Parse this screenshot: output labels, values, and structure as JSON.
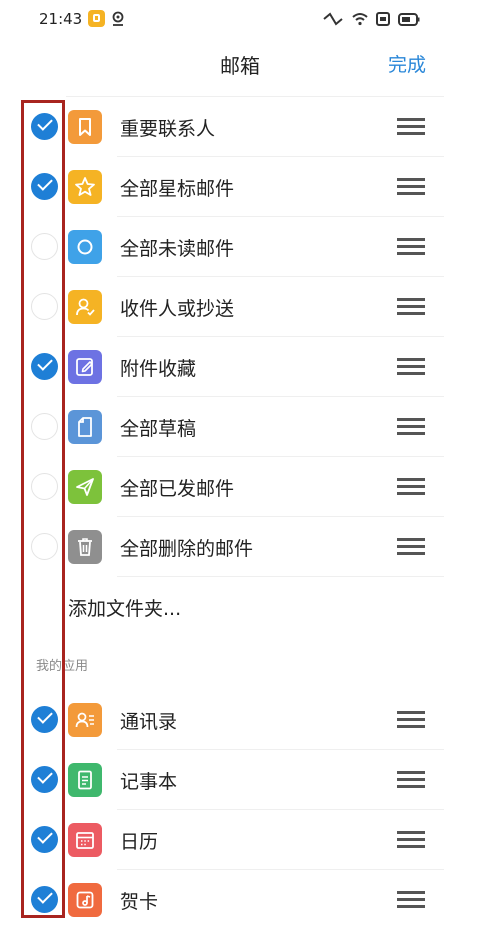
{
  "status_bar": {
    "time": "21:43"
  },
  "nav": {
    "title": "邮箱",
    "done_label": "完成"
  },
  "folders": [
    {
      "label": "重要联系人",
      "checked": true,
      "icon": "bookmark-icon",
      "color": "#f39a3a"
    },
    {
      "label": "全部星标邮件",
      "checked": true,
      "icon": "star-icon",
      "color": "#f5b324"
    },
    {
      "label": "全部未读邮件",
      "checked": false,
      "icon": "circle-icon",
      "color": "#3fa2e8"
    },
    {
      "label": "收件人或抄送",
      "checked": false,
      "icon": "person-icon",
      "color": "#f5b324"
    },
    {
      "label": "附件收藏",
      "checked": true,
      "icon": "edit-icon",
      "color": "#6d72e3"
    },
    {
      "label": "全部草稿",
      "checked": false,
      "icon": "document-icon",
      "color": "#5b95d8"
    },
    {
      "label": "全部已发邮件",
      "checked": false,
      "icon": "send-icon",
      "color": "#7dc23b"
    },
    {
      "label": "全部删除的邮件",
      "checked": false,
      "icon": "trash-icon",
      "color": "#8f8f8f"
    }
  ],
  "add_folder_label": "添加文件夹...",
  "apps_section_title": "我的应用",
  "apps": [
    {
      "label": "通讯录",
      "checked": true,
      "icon": "contacts-icon",
      "color": "#f39a3a"
    },
    {
      "label": "记事本",
      "checked": true,
      "icon": "notepad-icon",
      "color": "#3fb86d"
    },
    {
      "label": "日历",
      "checked": true,
      "icon": "calendar-icon",
      "color": "#ec5b62"
    },
    {
      "label": "贺卡",
      "checked": true,
      "icon": "card-icon",
      "color": "#f06a3f"
    }
  ],
  "colors": {
    "accent": "#1e7fd6",
    "highlight_border": "#a8241f"
  }
}
